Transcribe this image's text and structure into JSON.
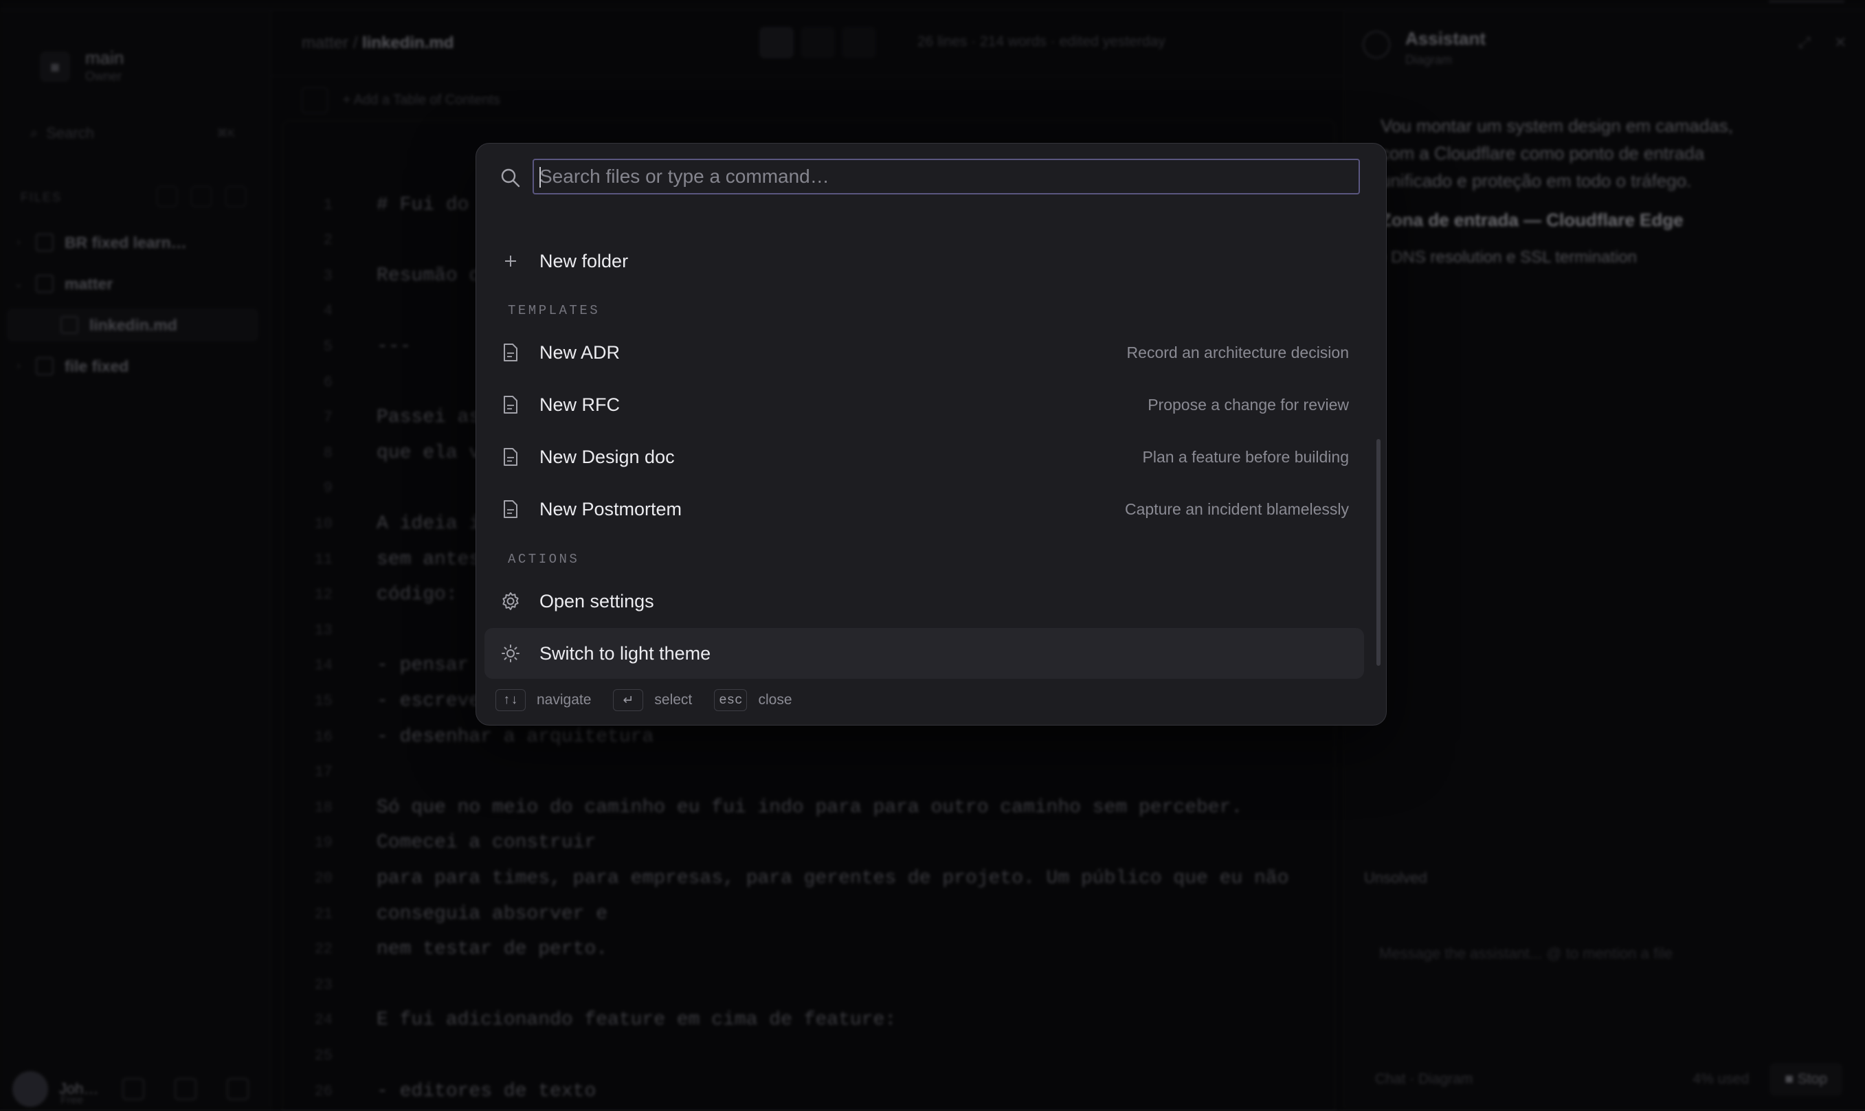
{
  "sidebar": {
    "workspace_name": "main",
    "workspace_sub": "Owner",
    "search_label": "Search",
    "search_kbd": "⌘K",
    "section_title": "FILES",
    "tree": [
      {
        "label": "BR fixed learn…"
      },
      {
        "label": "matter"
      },
      {
        "label": "linkedin.md"
      },
      {
        "label": "file fixed"
      }
    ],
    "user_name": "Joh…",
    "user_sub": "Free"
  },
  "editor": {
    "crumb_parent": "matter",
    "crumb_file": "linkedin.md",
    "stats": "26 lines · 214 words · edited yesterday",
    "sub_toolbar": "+ Add a Table of Contents",
    "lines": [
      {
        "n": "1",
        "text": "# Fui do"
      },
      {
        "n": "2",
        "text": ""
      },
      {
        "n": "3",
        "text": "Resumão d"
      },
      {
        "n": "4",
        "text": ""
      },
      {
        "n": "5",
        "text": "---"
      },
      {
        "n": "6",
        "text": ""
      },
      {
        "n": "7",
        "text": "Passei as"
      },
      {
        "n": "8",
        "text": "que ela v"
      },
      {
        "n": "9",
        "text": ""
      },
      {
        "n": "10",
        "text": "A ideia i"
      },
      {
        "n": "11",
        "text": "sem antes"
      },
      {
        "n": "12",
        "text": "código:"
      },
      {
        "n": "13",
        "text": ""
      },
      {
        "n": "14",
        "text": "- pensar"
      },
      {
        "n": "15",
        "text": "- escrever"
      },
      {
        "n": "16",
        "text": "- desenhar a arquitetura"
      },
      {
        "n": "17",
        "text": ""
      },
      {
        "n": "18",
        "text": "Só que no meio do caminho eu fui indo para para outro caminho sem perceber."
      },
      {
        "n": "19",
        "text": "Comecei a construir"
      },
      {
        "n": "20",
        "text": "para para times, para empresas, para gerentes de projeto. Um público que eu não"
      },
      {
        "n": "21",
        "text": "conseguia absorver e"
      },
      {
        "n": "22",
        "text": "nem testar de perto."
      },
      {
        "n": "23",
        "text": ""
      },
      {
        "n": "24",
        "text": "E fui adicionando feature em cima de feature:"
      },
      {
        "n": "25",
        "text": ""
      },
      {
        "n": "26",
        "text": "- editores de texto"
      }
    ]
  },
  "assistant": {
    "title": "Assistant",
    "subtitle": "Diagram",
    "message": "Vou montar um system design em camadas, com a Cloudflare como ponto de entrada unificado e proteção em todo o tráfego.",
    "heading": "Zona de entrada — Cloudflare Edge",
    "list_item": "• DNS resolution e SSL termination",
    "thread_label": "Unsolved",
    "input_placeholder": "Message the assistant... @ to mention a file",
    "footer_left": "Chat · Diagram",
    "footer_mid": "4% used",
    "stop_label": "■ Stop"
  },
  "palette": {
    "search_placeholder": "Search files or type a command…",
    "items": [
      {
        "label": "New folder",
        "icon": "plus-icon",
        "desc": ""
      }
    ],
    "sections": [
      {
        "title": "TEMPLATES",
        "items": [
          {
            "label": "New ADR",
            "icon": "document-icon",
            "desc": "Record an architecture decision"
          },
          {
            "label": "New RFC",
            "icon": "document-icon",
            "desc": "Propose a change for review"
          },
          {
            "label": "New Design doc",
            "icon": "document-icon",
            "desc": "Plan a feature before building"
          },
          {
            "label": "New Postmortem",
            "icon": "document-icon",
            "desc": "Capture an incident blamelessly"
          }
        ]
      },
      {
        "title": "ACTIONS",
        "items": [
          {
            "label": "Open settings",
            "icon": "gear-icon",
            "desc": ""
          },
          {
            "label": "Switch to light theme",
            "icon": "sun-icon",
            "desc": ""
          }
        ]
      }
    ],
    "footer": {
      "navigate_key": "↑↓",
      "navigate_label": "navigate",
      "select_key": "↵",
      "select_label": "select",
      "close_key": "esc",
      "close_label": "close"
    }
  },
  "colors": {
    "background": "#0b0b0d",
    "palette_bg": "#1d1d21",
    "input_focus_border": "#5a5680",
    "selected_row": "#26262b"
  }
}
